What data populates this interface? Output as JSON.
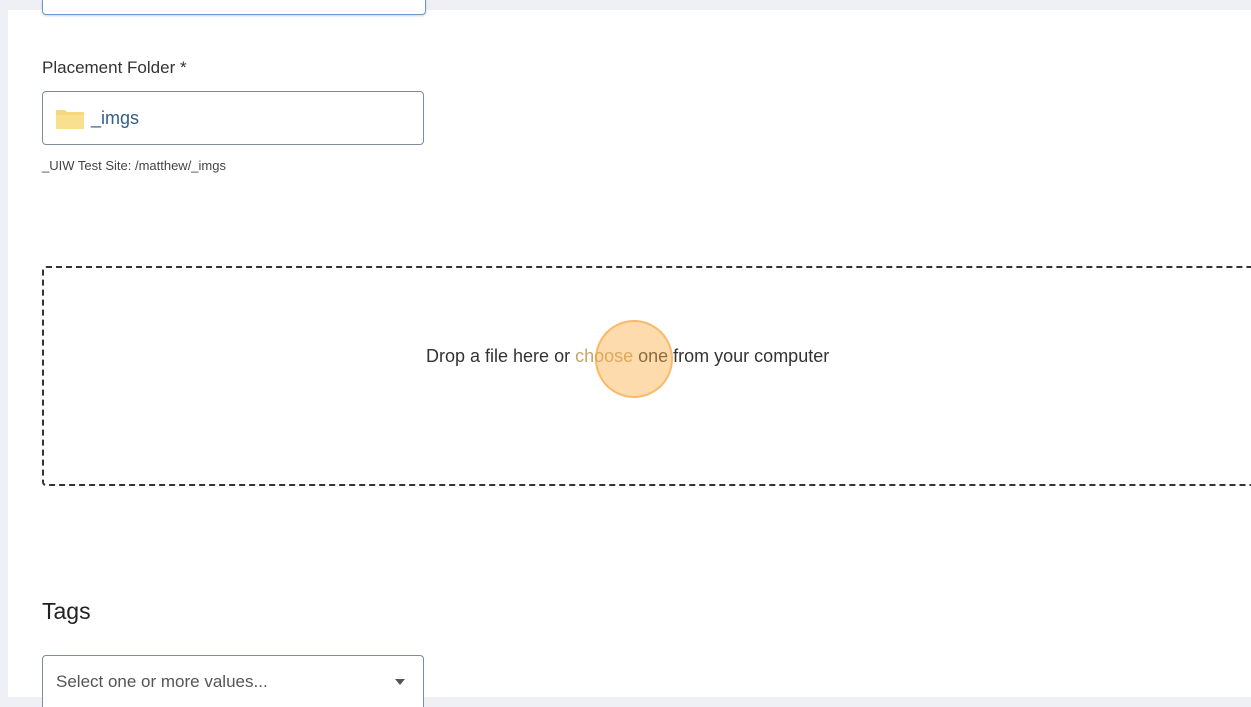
{
  "form": {
    "placement_folder": {
      "label": "Placement Folder *",
      "value": "_imgs",
      "icon": "folder-icon",
      "path_hint": "_UIW Test Site: /matthew/_imgs"
    },
    "dropzone": {
      "text_before": "Drop a file here or ",
      "link_text": "choose",
      "text_after": " one from your computer"
    },
    "tags": {
      "heading": "Tags",
      "placeholder": "Select one or more values...",
      "icon": "chevron-down-icon"
    }
  },
  "colors": {
    "page_background": "#eef0f6",
    "panel_background": "#ffffff",
    "folder_icon": "#f6d77b",
    "link_color": "#c8a36a",
    "click_highlight": "#faaf46"
  }
}
